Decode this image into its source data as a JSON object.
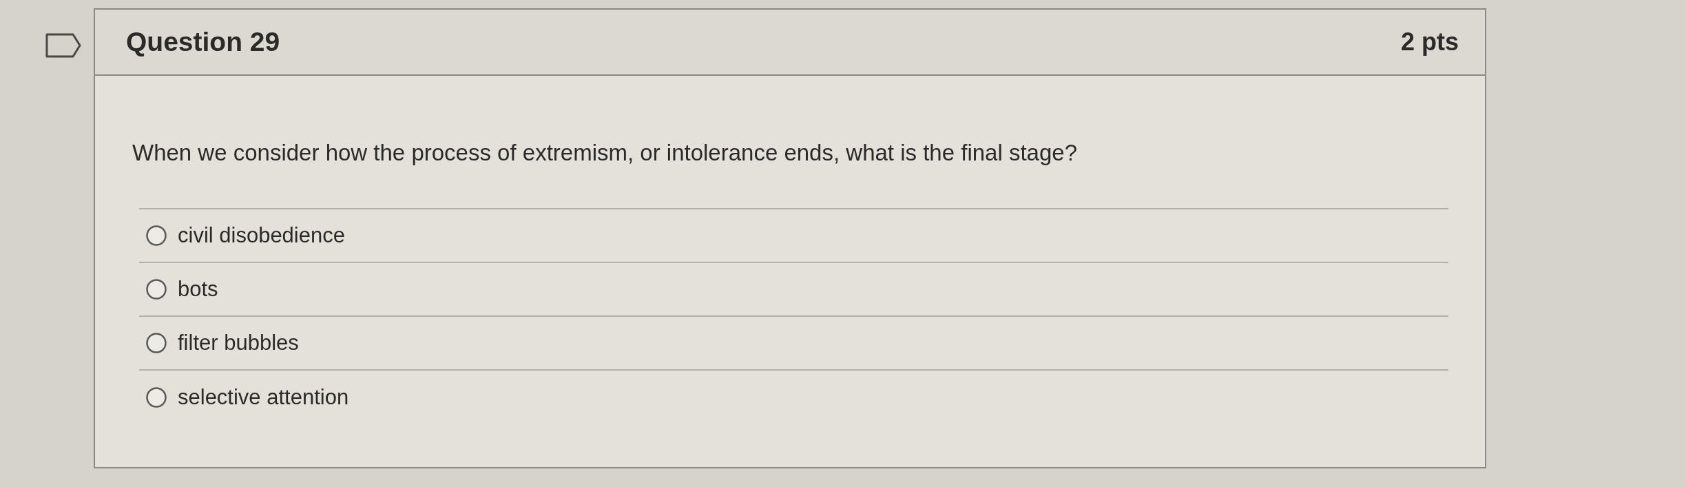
{
  "question": {
    "title": "Question 29",
    "points": "2 pts",
    "text": "When we consider how the process of extremism, or intolerance ends, what is the final stage?",
    "answers": [
      {
        "label": "civil disobedience",
        "selected": false
      },
      {
        "label": "bots",
        "selected": false
      },
      {
        "label": "filter bubbles",
        "selected": false
      },
      {
        "label": "selective attention",
        "selected": false
      }
    ]
  }
}
